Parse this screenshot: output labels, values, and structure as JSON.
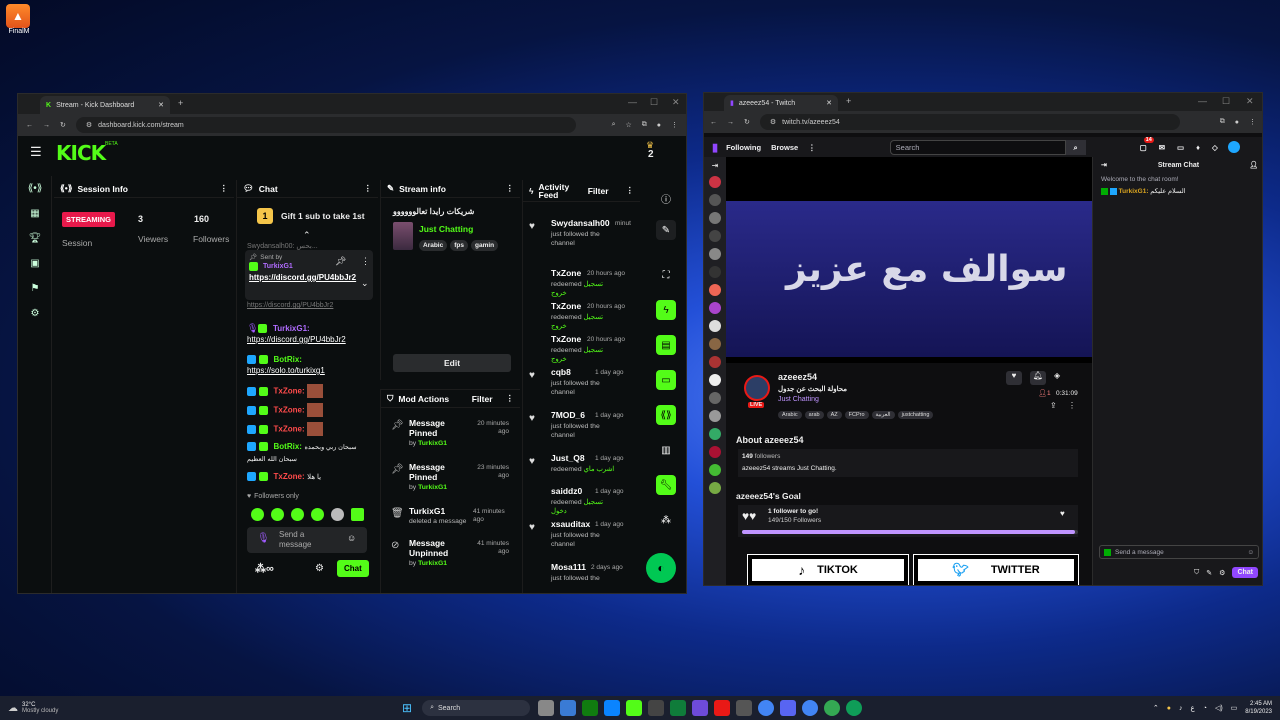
{
  "desktop": {
    "icon_label": "FinalM"
  },
  "kick": {
    "tab_title": "Stream - Kick Dashboard",
    "url": "dashboard.kick.com/stream",
    "logo": "KICK",
    "logo_beta": "BETA",
    "crown_count": "2",
    "session": {
      "title": "Session Info",
      "status": "STREAMING",
      "session_label": "Session",
      "viewers_value": "3",
      "viewers_label": "Viewers",
      "followers_value": "160",
      "followers_label": "Followers"
    },
    "chat": {
      "title": "Chat",
      "goal_text": "Gift 1 sub to take 1st",
      "goal_rank": "1",
      "pinned_sent_by": "Sent by",
      "pinned_user": "TurkixG1",
      "pinned_link": "https://discord.gg/PU4bbJr2",
      "faded_top": "Swydansalh00: بحس...",
      "faded_link": "https://discord.gg/PU4bbJr2",
      "messages": [
        {
          "user": "TurkixG1:",
          "text": "https://discord.gg/PU4bbJr2"
        },
        {
          "user": "BotRix:",
          "text": "https://solo.to/turkixg1"
        },
        {
          "user": "TxZone:",
          "text": ""
        },
        {
          "user": "TxZone:",
          "text": ""
        },
        {
          "user": "TxZone:",
          "text": ""
        },
        {
          "user": "BotRix:",
          "text": "سبحان ربي وبحمده سبحان الله العظيم"
        },
        {
          "user": "TxZone:",
          "text": "يا هلا"
        }
      ],
      "followers_only": "Followers only",
      "input_placeholder": "Send a message",
      "send_label": "Chat"
    },
    "stream_info": {
      "title": "Stream info",
      "stream_title": "شريكات رايدا تعالوووووو",
      "category": "Just Chatting",
      "tags": [
        "Arabic",
        "fps",
        "gamin"
      ],
      "edit_label": "Edit"
    },
    "mod_actions": {
      "title": "Mod Actions",
      "filter": "Filter",
      "items": [
        {
          "action": "Message Pinned",
          "by": "by",
          "user": "TurkixG1",
          "time": "20 minutes ago"
        },
        {
          "action": "Message Pinned",
          "by": "by",
          "user": "TurkixG1",
          "time": "23 minutes ago"
        },
        {
          "action": "TurkixG1",
          "by": "deleted a message",
          "user": "",
          "time": "41 minutes ago"
        },
        {
          "action": "Message Unpinned",
          "by": "by",
          "user": "TurkixG1",
          "time": "41 minutes ago"
        }
      ]
    },
    "activity": {
      "title": "Activity Feed",
      "filter": "Filter",
      "items": [
        {
          "name": "Swydansalh00",
          "time": "minut",
          "text": "just followed the channel",
          "reward": ""
        },
        {
          "name": "TxZone",
          "time": "20 hours ago",
          "text": "redeemed",
          "reward": "تسجيل خروج"
        },
        {
          "name": "TxZone",
          "time": "20 hours ago",
          "text": "redeemed",
          "reward": "تسجيل خروج"
        },
        {
          "name": "TxZone",
          "time": "20 hours ago",
          "text": "redeemed",
          "reward": "تسجيل خروج"
        },
        {
          "name": "cqb8",
          "time": "1 day ago",
          "text": "just followed the channel",
          "reward": ""
        },
        {
          "name": "7MOD_6",
          "time": "1 day ago",
          "text": "just followed the channel",
          "reward": ""
        },
        {
          "name": "Just_Q8",
          "time": "1 day ago",
          "text": "redeemed",
          "reward": "اشرب ماي"
        },
        {
          "name": "saiddz0",
          "time": "1 day ago",
          "text": "redeemed",
          "reward": "تسجيل دخول"
        },
        {
          "name": "xsauditax",
          "time": "1 day ago",
          "text": "just followed the channel",
          "reward": ""
        },
        {
          "name": "Mosa111",
          "time": "2 days ago",
          "text": "just followed the",
          "reward": ""
        }
      ]
    }
  },
  "twitch": {
    "tab_title": "azeeez54 - Twitch",
    "url": "twitch.tv/azeeez54",
    "nav_following": "Following",
    "nav_browse": "Browse",
    "search_placeholder": "Search",
    "notif_count": "14",
    "video_text": "سوالف مع عزيز",
    "channel_name": "azeeez54",
    "stream_title": "محاولة البحث عن جدول",
    "category": "Just Chatting",
    "live": "LIVE",
    "viewers": "1",
    "uptime": "0:31:09",
    "tags": [
      "Arabic",
      "arab",
      "AZ",
      "FCPro",
      "العربية",
      "justchatting"
    ],
    "about_title": "About azeeez54",
    "followers_count": "149",
    "followers_label": "followers",
    "about_text": "azeeez54 streams Just Chatting.",
    "goal_title": "azeeez54's Goal",
    "goal_main": "1 follower to go!",
    "goal_sub": "149/150 Followers",
    "goal_progress": 0.99,
    "panel_tiktok": "TIKTOK",
    "panel_twitter": "TWITTER",
    "chat_title": "Stream Chat",
    "chat_welcome": "Welcome to the chat room!",
    "chat_user": "TurkixG1:",
    "chat_msg": "السلام عليكم",
    "chat_placeholder": "Send a message",
    "chat_button": "Chat"
  },
  "taskbar": {
    "weather_temp": "32°C",
    "weather_desc": "Mostly cloudy",
    "search_label": "Search",
    "time": "2:45 AM",
    "date": "8/19/2023"
  }
}
